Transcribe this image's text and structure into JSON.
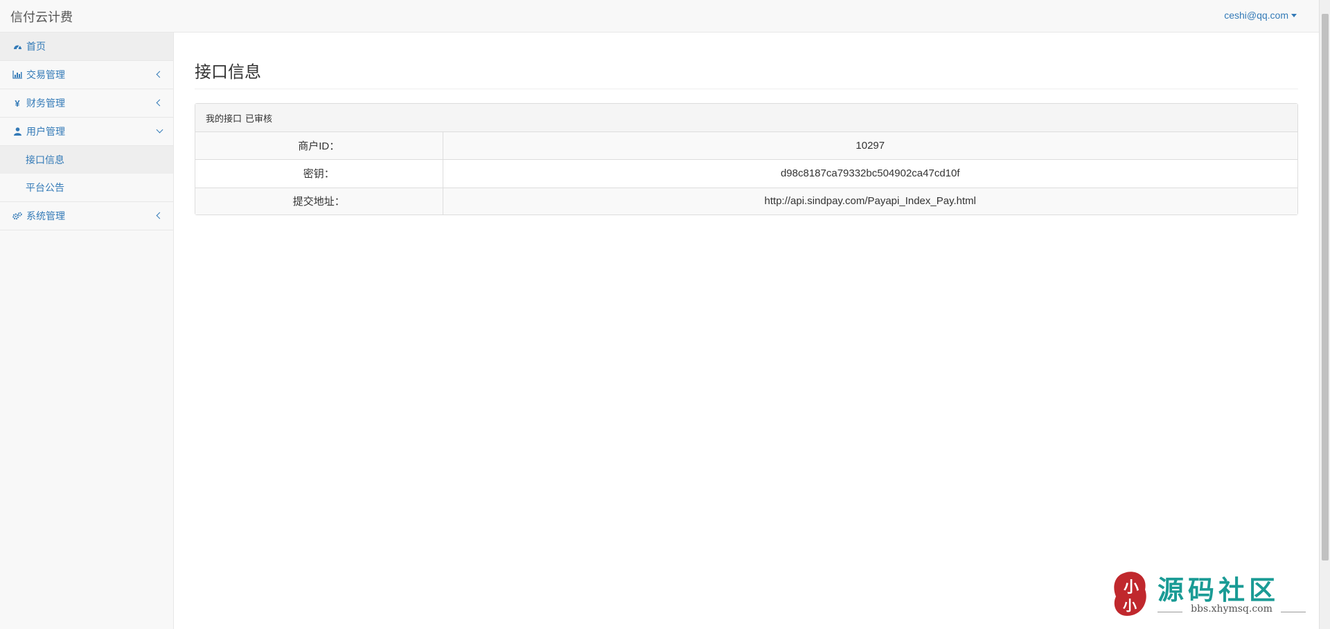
{
  "header": {
    "brand": "信付云计费",
    "user": "ceshi@qq.com"
  },
  "sidebar": {
    "items": [
      {
        "label": "首页",
        "icon": "dashboard-icon"
      },
      {
        "label": "交易管理",
        "icon": "bar-chart-icon"
      },
      {
        "label": "财务管理",
        "icon": "yen-icon"
      },
      {
        "label": "用户管理",
        "icon": "user-icon",
        "expanded": true,
        "children": [
          {
            "label": "接口信息"
          },
          {
            "label": "平台公告"
          }
        ]
      },
      {
        "label": "系统管理",
        "icon": "gears-icon"
      }
    ]
  },
  "main": {
    "title": "接口信息",
    "panel": {
      "heading": "我的接口",
      "status": "已审核",
      "rows": [
        {
          "label": "商户ID：",
          "value": "10297"
        },
        {
          "label": "密钥：",
          "value": "d98c8187ca79332bc504902ca47cd10f"
        },
        {
          "label": "提交地址：",
          "value": "http://api.sindpay.com/Payapi_Index_Pay.html"
        }
      ]
    }
  },
  "watermark": {
    "seal": "小小",
    "title": "源码社区",
    "url": "bbs.xhymsq.com"
  },
  "colors": {
    "link": "#337ab7",
    "sidebar_bg": "#f8f8f8",
    "active_bg": "#eeeeee",
    "watermark_teal": "#1a9b95",
    "watermark_seal": "#c0282d"
  }
}
